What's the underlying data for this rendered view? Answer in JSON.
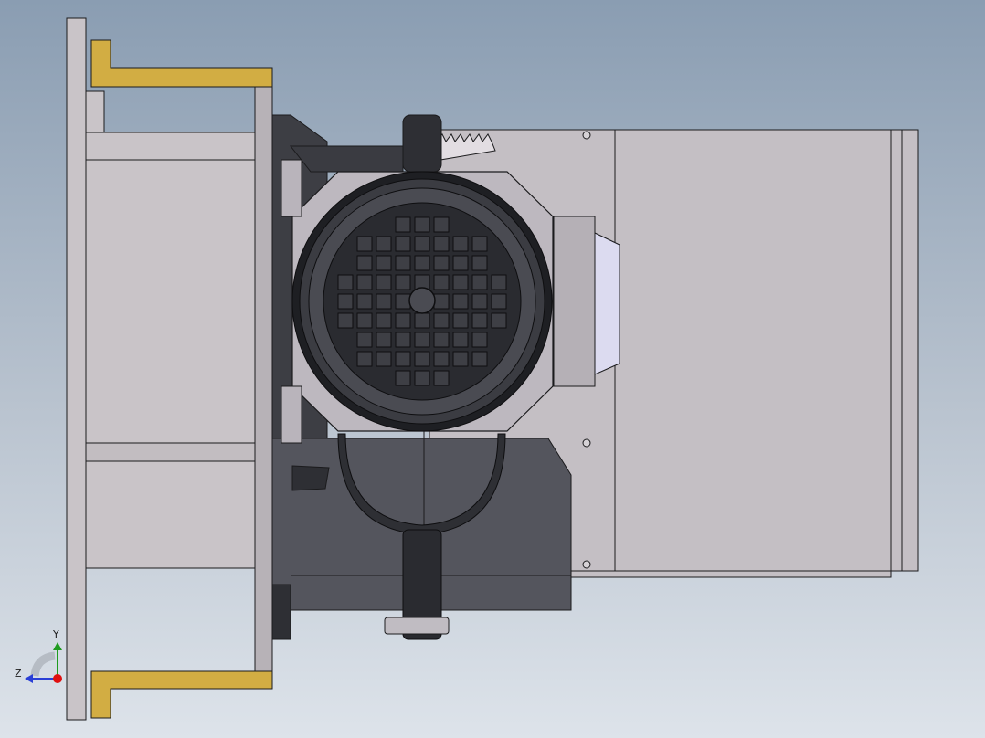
{
  "triad": {
    "y_label": "Y",
    "z_label": "Z",
    "colors": {
      "y": "#1f9b1f",
      "z": "#2a3fd6",
      "x": "#e01010"
    }
  },
  "colors": {
    "background_top": "#8a9db2",
    "background_bottom": "#dde3ea",
    "frame_gray": "#c9c4c8",
    "dark_body": "#4f5057",
    "brass": "#d2ad43",
    "edge": "#1b1b1d"
  }
}
